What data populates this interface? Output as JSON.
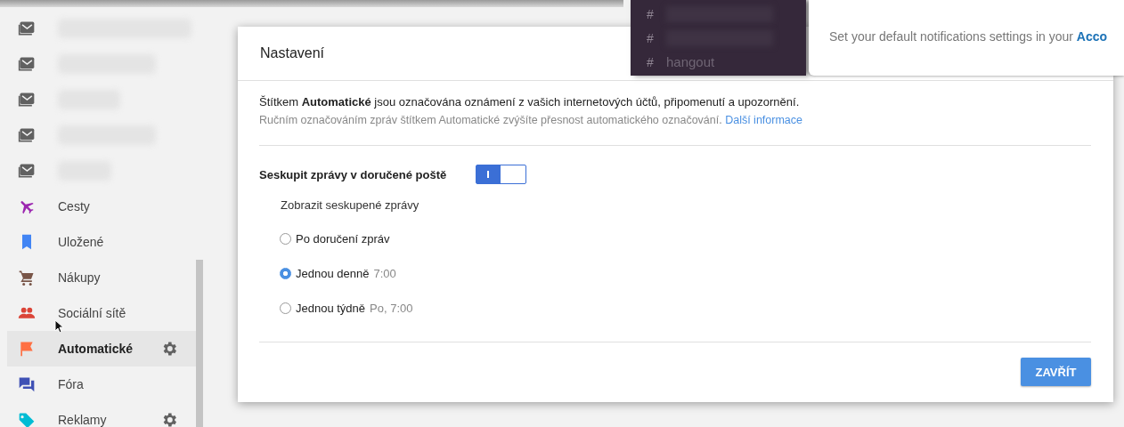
{
  "sidebar": {
    "items": [
      {
        "kind": "blurred",
        "selected": false,
        "gear": false
      },
      {
        "kind": "blurred",
        "selected": false,
        "gear": false
      },
      {
        "kind": "blurred",
        "selected": false,
        "gear": false
      },
      {
        "kind": "blurred",
        "selected": false,
        "gear": false
      },
      {
        "kind": "blurred",
        "selected": false,
        "gear": false
      },
      {
        "kind": "label",
        "label": "Cesty",
        "color": "#9c27b0",
        "selected": false,
        "gear": false
      },
      {
        "kind": "label",
        "label": "Uložené",
        "color": "#4285f4",
        "selected": false,
        "gear": false
      },
      {
        "kind": "label",
        "label": "Nákupy",
        "color": "#795548",
        "selected": false,
        "gear": false
      },
      {
        "kind": "label",
        "label": "Sociální sítě",
        "color": "#db4437",
        "selected": false,
        "gear": false
      },
      {
        "kind": "label",
        "label": "Automatické",
        "color": "#ff7043",
        "selected": true,
        "gear": true
      },
      {
        "kind": "label",
        "label": "Fóra",
        "color": "#3f51b5",
        "selected": false,
        "gear": false
      },
      {
        "kind": "label",
        "label": "Reklamy",
        "color": "#00bcd4",
        "selected": false,
        "gear": true
      }
    ]
  },
  "dialog": {
    "title": "Nastavení",
    "intro": "Štítkem **Automatické** jsou označována oznámení z vašich internetových účtů, připomenutí a upozornění.",
    "hint": "Ručním označováním zpráv štítkem Automatické zvýšíte přesnost automatického označování.",
    "link": "Další informace",
    "toggle": {
      "label": "Seskupit zprávy v doručené poště",
      "on": true
    },
    "group_label": "Zobrazit seskupené zprávy",
    "radios": [
      {
        "label": "Po doručení zpráv",
        "selected": false
      },
      {
        "label": "Jednou denně",
        "detail": "7:00",
        "selected": true
      },
      {
        "label": "Jednou týdně",
        "detail": "Po, 7:00",
        "selected": false
      }
    ],
    "button": "ZAVŘÍT"
  },
  "chat_sidebar": {
    "channels": [
      {
        "hash": "#"
      },
      {
        "hash": "#"
      },
      {
        "hash": "#",
        "name": "hangout"
      }
    ]
  },
  "notification_popup": {
    "text": "Set your default notifications settings in your",
    "link": "Acco"
  }
}
